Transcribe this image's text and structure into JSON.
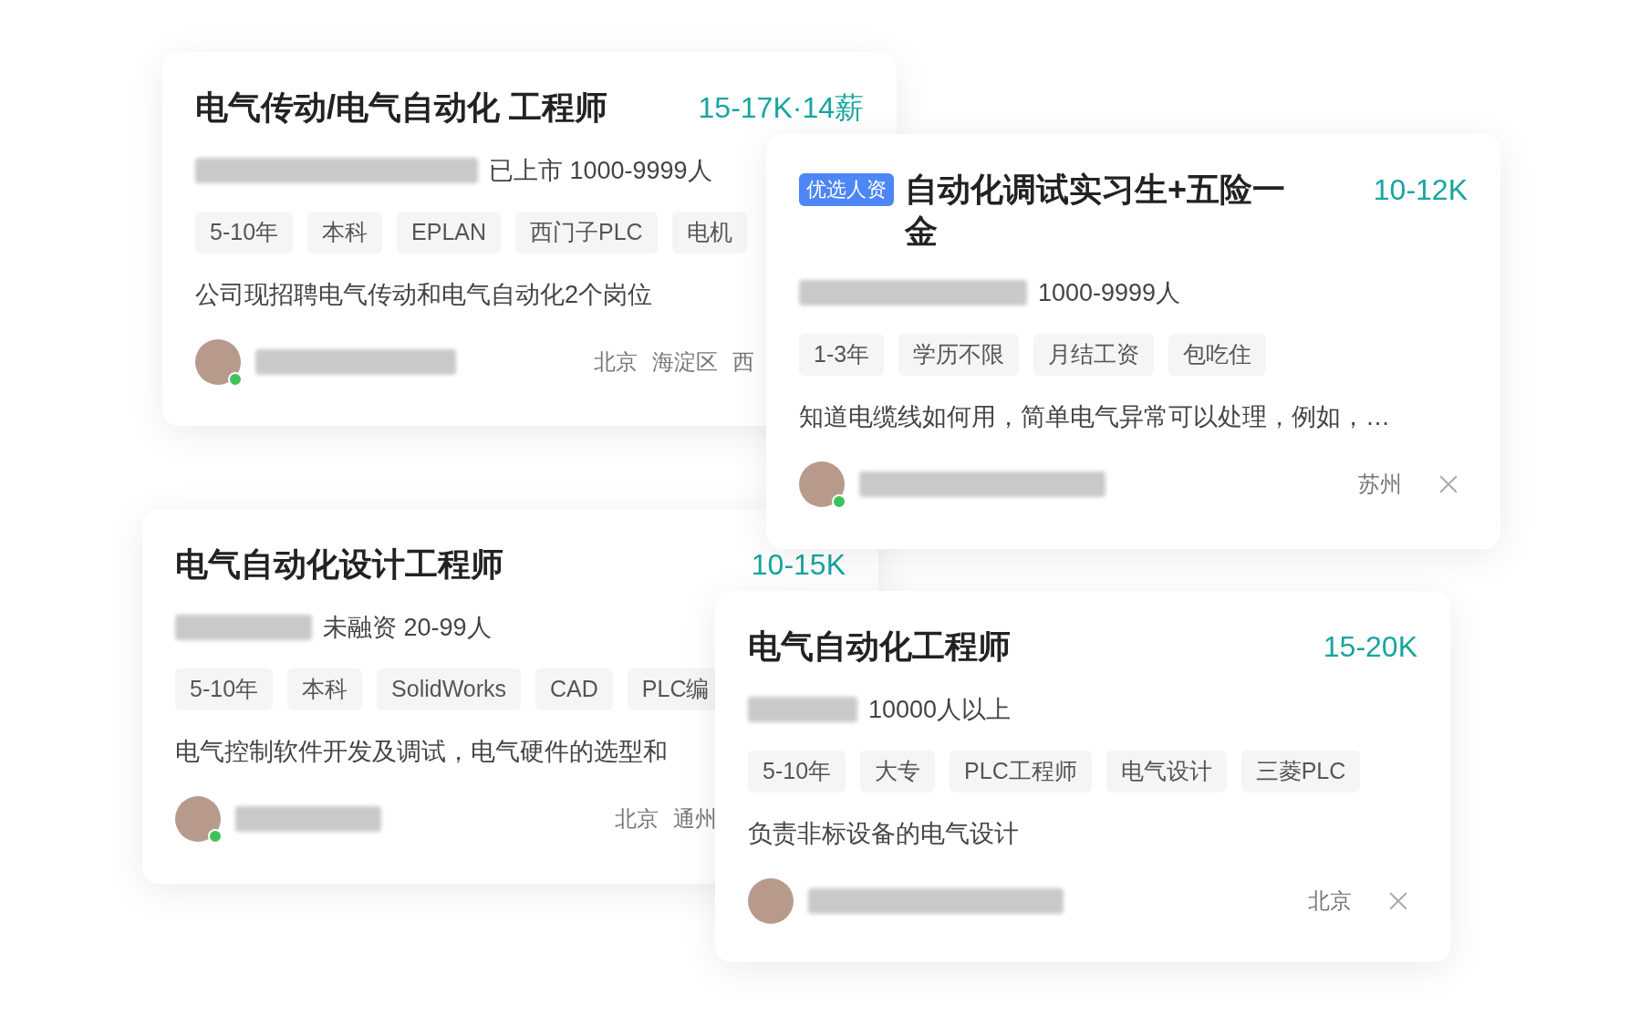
{
  "cards": [
    {
      "title": "电气传动/电气自动化 工程师",
      "salary": "15-17K·14薪",
      "company_info": "已上市 1000-9999人",
      "tags": [
        "5-10年",
        "本科",
        "EPLAN",
        "西门子PLC",
        "电机"
      ],
      "description": "公司现招聘电气传动和电气自动化2个岗位",
      "online": true,
      "location": [
        "北京",
        "海淀区",
        "西"
      ]
    },
    {
      "title": "电气自动化设计工程师",
      "salary": "10-15K",
      "company_info": "未融资 20-99人",
      "tags": [
        "5-10年",
        "本科",
        "SolidWorks",
        "CAD",
        "PLC编"
      ],
      "description": "电气控制软件开发及调试，电气硬件的选型和",
      "online": true,
      "location": [
        "北京",
        "通州"
      ]
    },
    {
      "title": "自动化调试实习生+五险一金",
      "badge": "优选人资",
      "salary": "10-12K",
      "company_info": "1000-9999人",
      "tags": [
        "1-3年",
        "学历不限",
        "月结工资",
        "包吃住"
      ],
      "description": "知道电缆线如何用，简单电气异常可以处理，例如，…",
      "online": true,
      "location": [
        "苏州"
      ]
    },
    {
      "title": "电气自动化工程师",
      "salary": "15-20K",
      "company_info": "10000人以上",
      "tags": [
        "5-10年",
        "大专",
        "PLC工程师",
        "电气设计",
        "三菱PLC"
      ],
      "description": "负责非标设备的电气设计",
      "online": false,
      "location": [
        "北京"
      ]
    }
  ]
}
